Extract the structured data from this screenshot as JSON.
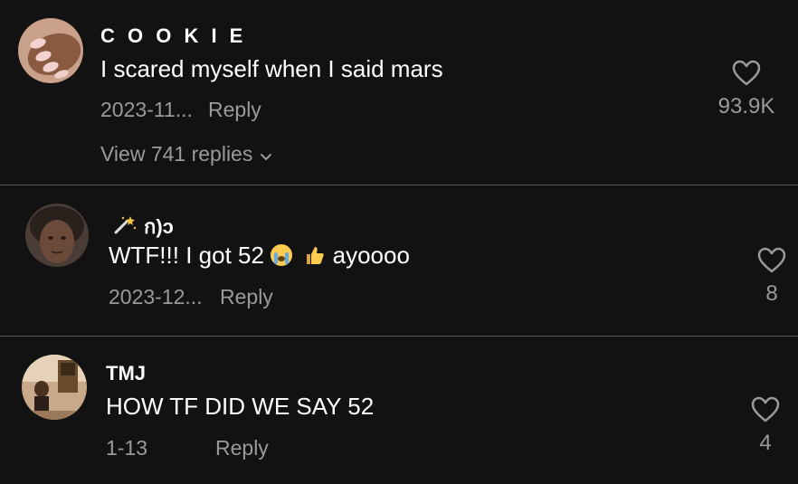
{
  "comments": [
    {
      "username": "C O O K I E",
      "text": "I scared myself when I said mars",
      "date": "2023-11...",
      "reply_label": "Reply",
      "likes": "93.9K",
      "view_replies": "View 741 replies"
    },
    {
      "username_icon": "magic-wand-icon",
      "username": "ก)ɔ",
      "text_before": "WTF!!! I got 52",
      "emoji_1": "crying-face-emoji",
      "emoji_2": "thumbs-up-emoji",
      "text_after": "ayoooo",
      "date": "2023-12...",
      "reply_label": "Reply",
      "likes": "8"
    },
    {
      "username": "TMJ",
      "text": "HOW TF DID WE SAY 52",
      "date": "1-13",
      "reply_label": "Reply",
      "likes": "4"
    }
  ],
  "colors": {
    "background": "#121212",
    "text": "#ffffff",
    "secondary_text": "#9a9a9a",
    "divider": "#5a5a5a"
  }
}
